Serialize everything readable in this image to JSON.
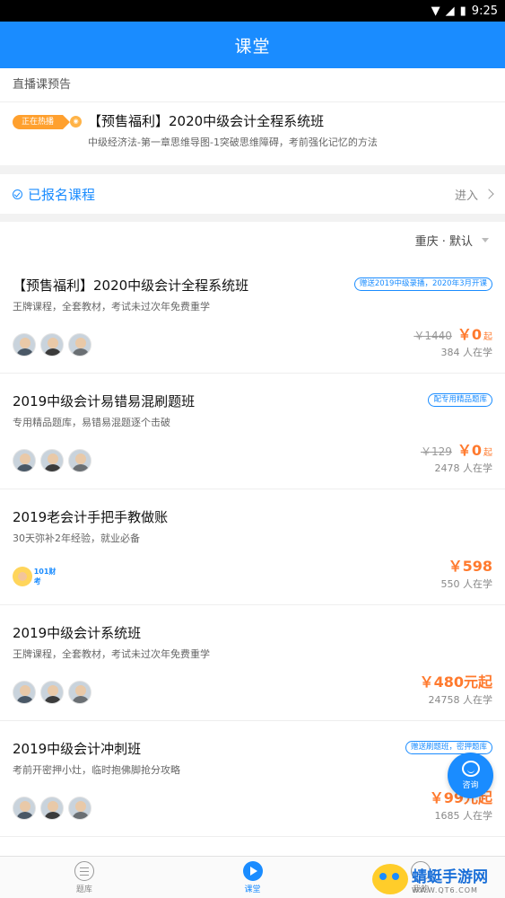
{
  "status_bar": {
    "time": "9:25"
  },
  "app_bar": {
    "title": "课堂"
  },
  "live": {
    "header": "直播课预告",
    "badge": "正在热播",
    "title": "【预售福利】2020中级会计全程系统班",
    "desc": "中级经济法-第一章思维导图-1突破思维障碍，考前强化记忆的方法"
  },
  "enrolled": {
    "label": "已报名课程",
    "enter": "进入"
  },
  "filter": {
    "label": "重庆 · 默认"
  },
  "courses": [
    {
      "title": "【预售福利】2020中级会计全程系统班",
      "desc": "王牌课程，全套教材，考试未过次年免费重学",
      "tag": "赠送2019中级录播，2020年3月开课",
      "old_price": "￥1440",
      "price": "￥0",
      "suffix": "起",
      "students": "384 人在学"
    },
    {
      "title": "2019中级会计易错易混刷题班",
      "desc": "专用精品题库，易错易混题逐个击破",
      "tag": "配专用精品题库",
      "old_price": "￥129",
      "price": "￥0",
      "suffix": "起",
      "students": "2478 人在学"
    },
    {
      "title": "2019老会计手把手教做账",
      "desc": "30天弥补2年经验，就业必备",
      "tag": "",
      "old_price": "",
      "price": "￥598",
      "suffix": "",
      "students": "550 人在学",
      "brand": "101财考"
    },
    {
      "title": "2019中级会计系统班",
      "desc": "王牌课程，全套教材，考试未过次年免费重学",
      "tag": "",
      "old_price": "",
      "price": "￥480元起",
      "suffix": "",
      "students": "24758 人在学"
    },
    {
      "title": "2019中级会计冲刺班",
      "desc": "考前开密押小灶，临时抱佛脚抢分攻略",
      "tag": "赠送刷题班，密押题库",
      "old_price": "",
      "price": "￥99元起",
      "suffix": "",
      "students": "1685 人在学"
    }
  ],
  "fab": {
    "label": "咨询"
  },
  "bottom_nav": [
    {
      "label": "题库",
      "icon": "question-bank-icon"
    },
    {
      "label": "课堂",
      "icon": "classroom-play-icon"
    },
    {
      "label": "我的",
      "icon": "profile-icon"
    }
  ],
  "watermark": {
    "name": "蜻蜓手游网",
    "url": "WWW.QT6.COM"
  },
  "colors": {
    "primary": "#1a8cff",
    "price": "#ff7a2e",
    "badge": "#ffa02e"
  }
}
